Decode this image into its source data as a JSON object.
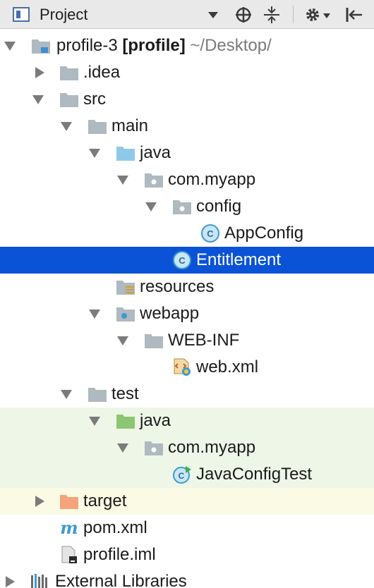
{
  "toolbar": {
    "title": "Project",
    "icons": [
      "project-view-icon",
      "dropdown-icon",
      "locate-icon",
      "collapse-all-icon",
      "gear-icon",
      "hide-panel-icon"
    ]
  },
  "tree": {
    "root": {
      "name": "profile-3",
      "module": "[profile]",
      "path": "~/Desktop/"
    },
    "idea": ".idea",
    "src": "src",
    "main": "main",
    "main_java": "java",
    "main_pkg": "com.myapp",
    "config": "config",
    "appconfig": "AppConfig",
    "entitlement": "Entitlement",
    "resources": "resources",
    "webapp": "webapp",
    "webinf": "WEB-INF",
    "webxml": "web.xml",
    "test": "test",
    "test_java": "java",
    "test_pkg": "com.myapp",
    "javaconfigtest": "JavaConfigTest",
    "target": "target",
    "pom": "pom.xml",
    "iml": "profile.iml",
    "extlibs": "External Libraries"
  },
  "colors": {
    "selection": "#0b53d6",
    "test_bg": "#eef6e7",
    "excluded_bg": "#fbfae5",
    "folder": "#aeb9c0",
    "source_folder": "#8fc9ea",
    "test_folder": "#8cc672",
    "excluded_folder": "#f4a37a",
    "class_icon": "#3e9bd2"
  }
}
